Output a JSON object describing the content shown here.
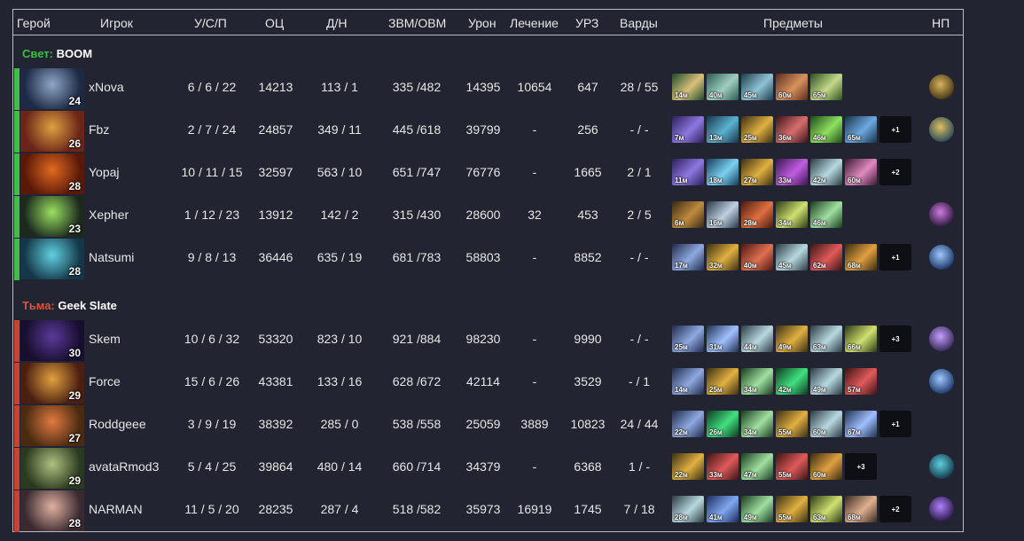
{
  "headers": [
    "Герой",
    "Игрок",
    "У/С/П",
    "ОЦ",
    "Д/Н",
    "ЗВМ/ОВМ",
    "Урон",
    "Лечение",
    "УРЗ",
    "Варды",
    "Предметы",
    "НП"
  ],
  "teams": [
    {
      "side": "Свет:",
      "name": "BOOM",
      "color": "#3fbf46",
      "players": [
        {
          "hero_icon": "mirana-portrait",
          "hero_colors": [
            "#1c2a44",
            "#8fa6c8"
          ],
          "level": "24",
          "player": "xNova",
          "kda": "6 / 6 / 22",
          "nw": "14213",
          "lh_dn": "113 / 1",
          "gpm_xpm": "335 /482",
          "damage": "14395",
          "heal": "10654",
          "building": "647",
          "wards": "28 / 55",
          "items": [
            {
              "name": "item-staff",
              "time": "14м",
              "colors": [
                "#1c4a2a",
                "#d9c07a"
              ]
            },
            {
              "name": "item-boots",
              "time": "40м",
              "colors": [
                "#2a5a52",
                "#9fd0c0"
              ]
            },
            {
              "name": "item-crystal",
              "time": "45м",
              "colors": [
                "#1d3c4a",
                "#8fc3d4"
              ]
            },
            {
              "name": "item-sword",
              "time": "60м",
              "colors": [
                "#5a2a1e",
                "#d8925c"
              ]
            },
            {
              "name": "item-orb",
              "time": "65м",
              "colors": [
                "#2c5020",
                "#c4d88a"
              ]
            }
          ],
          "np": {
            "name": "neutral-amulet-icon",
            "colors": [
              "#4a3a18",
              "#d8b25a"
            ]
          }
        },
        {
          "hero_icon": "brewmaster-portrait",
          "hero_colors": [
            "#6a2418",
            "#e0a040"
          ],
          "level": "26",
          "player": "Fbz",
          "kda": "2 / 7 / 24",
          "nw": "24857",
          "lh_dn": "349 / 11",
          "gpm_xpm": "445 /618",
          "damage": "39799",
          "heal": "-",
          "building": "256",
          "wards": "- / -",
          "items": [
            {
              "name": "item-arcane",
              "time": "7м",
              "colors": [
                "#2a1e5a",
                "#8e78e0"
              ]
            },
            {
              "name": "item-glimmer",
              "time": "13м",
              "colors": [
                "#16364a",
                "#5ab2d0"
              ]
            },
            {
              "name": "item-blink",
              "time": "25м",
              "colors": [
                "#3a2e14",
                "#e0b040"
              ]
            },
            {
              "name": "item-skull",
              "time": "36м",
              "colors": [
                "#3a1418",
                "#d86e6e"
              ]
            },
            {
              "name": "item-lotus",
              "time": "46м",
              "colors": [
                "#1e4a18",
                "#8ee060"
              ]
            },
            {
              "name": "item-heart",
              "time": "65м",
              "colors": [
                "#16324a",
                "#6ea8e0"
              ]
            },
            {
              "name": "item-more",
              "time": "+1",
              "more": true
            }
          ],
          "np": {
            "name": "neutral-compass-icon",
            "colors": [
              "#2a4a5a",
              "#e0c060"
            ]
          }
        },
        {
          "hero_icon": "ember-portrait",
          "hero_colors": [
            "#5a1808",
            "#e06a20"
          ],
          "level": "28",
          "player": "Yopaj",
          "kda": "10 / 11 / 15",
          "nw": "32597",
          "lh_dn": "563 / 10",
          "gpm_xpm": "651 /747",
          "damage": "76776",
          "heal": "-",
          "building": "1665",
          "wards": "2 / 1",
          "items": [
            {
              "name": "item-arcane",
              "time": "11м",
              "colors": [
                "#2a1e5a",
                "#8e78e0"
              ]
            },
            {
              "name": "item-swirl",
              "time": "18м",
              "colors": [
                "#163c5a",
                "#7ad0f0"
              ]
            },
            {
              "name": "item-blink",
              "time": "27м",
              "colors": [
                "#3a2e14",
                "#e0b040"
              ]
            },
            {
              "name": "item-dagon",
              "time": "33м",
              "colors": [
                "#3a1450",
                "#c05ee0"
              ]
            },
            {
              "name": "item-satanic",
              "time": "42м",
              "colors": [
                "#2a3a40",
                "#b8d8e0"
              ]
            },
            {
              "name": "item-butterfly",
              "time": "60м",
              "colors": [
                "#3a1830",
                "#e08ac0"
              ]
            },
            {
              "name": "item-more",
              "time": "+2",
              "more": true
            }
          ],
          "np": {
            "name": "neutral-empty",
            "colors": [
              "#222531",
              "#222531"
            ]
          }
        },
        {
          "hero_icon": "void-portrait",
          "hero_colors": [
            "#1c2a1e",
            "#9ae060"
          ],
          "level": "23",
          "player": "Xepher",
          "kda": "1 / 12 / 23",
          "nw": "13912",
          "lh_dn": "142 / 2",
          "gpm_xpm": "315 /430",
          "damage": "28600",
          "heal": "32",
          "building": "453",
          "wards": "2 / 5",
          "items": [
            {
              "name": "item-tranquil",
              "time": "6м",
              "colors": [
                "#3a2810",
                "#c08a40"
              ]
            },
            {
              "name": "item-force",
              "time": "16м",
              "colors": [
                "#263848",
                "#c0d0e0"
              ]
            },
            {
              "name": "item-rapier",
              "time": "28м",
              "colors": [
                "#4a1a10",
                "#e07040"
              ]
            },
            {
              "name": "item-radiance",
              "time": "34м",
              "colors": [
                "#2a3a14",
                "#d0e070"
              ]
            },
            {
              "name": "item-aghs",
              "time": "46м",
              "colors": [
                "#1a3a20",
                "#a0e0a0"
              ]
            }
          ],
          "np": {
            "name": "neutral-spear-icon",
            "colors": [
              "#2a1838",
              "#d07ae0"
            ]
          }
        },
        {
          "hero_icon": "morph-portrait",
          "hero_colors": [
            "#14384a",
            "#60d0e0"
          ],
          "level": "28",
          "player": "Natsumi",
          "kda": "9 / 8 / 13",
          "nw": "36446",
          "lh_dn": "635 / 19",
          "gpm_xpm": "681 /783",
          "damage": "58803",
          "heal": "-",
          "building": "8852",
          "wards": "- / -",
          "items": [
            {
              "name": "item-manta",
              "time": "17м",
              "colors": [
                "#1e2a4a",
                "#8ea8e0"
              ]
            },
            {
              "name": "item-blink",
              "time": "32м",
              "colors": [
                "#3a2e14",
                "#e0b040"
              ]
            },
            {
              "name": "item-daedalus",
              "time": "40м",
              "colors": [
                "#4a1610",
                "#e07050"
              ]
            },
            {
              "name": "item-satanic",
              "time": "45м",
              "colors": [
                "#2a3a40",
                "#b8d8e0"
              ]
            },
            {
              "name": "item-bloodthorn",
              "time": "62м",
              "colors": [
                "#3a1414",
                "#e05a5a"
              ]
            },
            {
              "name": "item-skadi",
              "time": "68м",
              "colors": [
                "#3a2a10",
                "#e0a040"
              ]
            },
            {
              "name": "item-more",
              "time": "+1",
              "more": true
            }
          ],
          "np": {
            "name": "neutral-orb-icon",
            "colors": [
              "#1e3a6a",
              "#a0c8ff"
            ]
          }
        }
      ]
    },
    {
      "side": "Тьма:",
      "name": "Geek Slate",
      "color": "#d8543e",
      "players": [
        {
          "hero_icon": "spectre-portrait",
          "hero_colors": [
            "#180e2e",
            "#5a3a9a"
          ],
          "level": "30",
          "player": "Skem",
          "kda": "10 / 6 / 32",
          "nw": "53320",
          "lh_dn": "823 / 10",
          "gpm_xpm": "921 /884",
          "damage": "98230",
          "heal": "-",
          "building": "9990",
          "wards": "- / -",
          "items": [
            {
              "name": "item-manta",
              "time": "25м",
              "colors": [
                "#1e2a4a",
                "#8ea8e0"
              ]
            },
            {
              "name": "item-ethereal",
              "time": "31м",
              "colors": [
                "#1e3050",
                "#a0c0ff"
              ]
            },
            {
              "name": "item-satanic",
              "time": "44м",
              "colors": [
                "#2a3a40",
                "#b8d8e0"
              ]
            },
            {
              "name": "item-blink",
              "time": "49м",
              "colors": [
                "#3a2e14",
                "#e0b040"
              ]
            },
            {
              "name": "item-skadi",
              "time": "63м",
              "colors": [
                "#2a3a40",
                "#b8d8e0"
              ]
            },
            {
              "name": "item-radiance",
              "time": "66м",
              "colors": [
                "#2a3a14",
                "#d0e070"
              ]
            },
            {
              "name": "item-more",
              "time": "+3",
              "more": true
            }
          ],
          "np": {
            "name": "neutral-mirror-icon",
            "colors": [
              "#3a2a5a",
              "#c0a0ff"
            ]
          }
        },
        {
          "hero_icon": "lion-portrait",
          "hero_colors": [
            "#4a1e10",
            "#e0a040"
          ],
          "level": "29",
          "player": "Force",
          "kda": "15 / 6 / 26",
          "nw": "43381",
          "lh_dn": "133 / 16",
          "gpm_xpm": "628 /672",
          "damage": "42114",
          "heal": "-",
          "building": "3529",
          "wards": "- / 1",
          "items": [
            {
              "name": "item-manta",
              "time": "14м",
              "colors": [
                "#1e2a4a",
                "#8ea8e0"
              ]
            },
            {
              "name": "item-blink",
              "time": "25м",
              "colors": [
                "#3a2e14",
                "#e0b040"
              ]
            },
            {
              "name": "item-aghs",
              "time": "34м",
              "colors": [
                "#1a3a20",
                "#a0e0a0"
              ]
            },
            {
              "name": "item-emerald",
              "time": "42м",
              "colors": [
                "#0e3a1e",
                "#40e080"
              ]
            },
            {
              "name": "item-satanic",
              "time": "49м",
              "colors": [
                "#2a3a40",
                "#b8d8e0"
              ]
            },
            {
              "name": "item-bloodthorn",
              "time": "57м",
              "colors": [
                "#3a1414",
                "#e05a5a"
              ]
            }
          ],
          "np": {
            "name": "neutral-orb-icon",
            "colors": [
              "#1e3a6a",
              "#a0c8ff"
            ]
          }
        },
        {
          "hero_icon": "windrunner-portrait",
          "hero_colors": [
            "#4a2a10",
            "#e07a40"
          ],
          "level": "27",
          "player": "Roddgeee",
          "kda": "3 / 9 / 19",
          "nw": "38392",
          "lh_dn": "285 / 0",
          "gpm_xpm": "538 /558",
          "damage": "25059",
          "heal": "3889",
          "building": "10823",
          "wards": "24 / 44",
          "items": [
            {
              "name": "item-manta",
              "time": "22м",
              "colors": [
                "#1e2a4a",
                "#8ea8e0"
              ]
            },
            {
              "name": "item-emerald",
              "time": "26м",
              "colors": [
                "#0e3a1e",
                "#40e080"
              ]
            },
            {
              "name": "item-aghs",
              "time": "34м",
              "colors": [
                "#1a3a20",
                "#a0e0a0"
              ]
            },
            {
              "name": "item-blink",
              "time": "55м",
              "colors": [
                "#3a2e14",
                "#e0b040"
              ]
            },
            {
              "name": "item-satanic",
              "time": "60м",
              "colors": [
                "#2a3a40",
                "#b8d8e0"
              ]
            },
            {
              "name": "item-ethereal",
              "time": "67м",
              "colors": [
                "#1e3050",
                "#a0c0ff"
              ]
            },
            {
              "name": "item-more",
              "time": "+1",
              "more": true
            }
          ],
          "np": {
            "name": "neutral-empty",
            "colors": [
              "#222531",
              "#222531"
            ]
          }
        },
        {
          "hero_icon": "sand-king-portrait",
          "hero_colors": [
            "#2a3a1e",
            "#b0c080"
          ],
          "level": "29",
          "player": "avataRmod3",
          "kda": "5 / 4 / 25",
          "nw": "39864",
          "lh_dn": "480 / 14",
          "gpm_xpm": "660 /714",
          "damage": "34379",
          "heal": "-",
          "building": "6368",
          "wards": "1 / -",
          "items": [
            {
              "name": "item-blink",
              "time": "22м",
              "colors": [
                "#3a2e14",
                "#e0b040"
              ]
            },
            {
              "name": "item-bloodthorn",
              "time": "33м",
              "colors": [
                "#3a1414",
                "#e05a5a"
              ]
            },
            {
              "name": "item-aghs",
              "time": "47м",
              "colors": [
                "#1a3a20",
                "#a0e0a0"
              ]
            },
            {
              "name": "item-bloodthorn",
              "time": "55м",
              "colors": [
                "#3a1414",
                "#e05a5a"
              ]
            },
            {
              "name": "item-skadi",
              "time": "60м",
              "colors": [
                "#3a2a10",
                "#e0a040"
              ]
            },
            {
              "name": "item-more",
              "time": "+3",
              "more": true
            }
          ],
          "np": {
            "name": "neutral-lens-icon",
            "colors": [
              "#143a4a",
              "#60d0e0"
            ]
          }
        },
        {
          "hero_icon": "tinker-portrait",
          "hero_colors": [
            "#3a2a30",
            "#e0b0a0"
          ],
          "level": "28",
          "player": "NARMAN",
          "kda": "11 / 5 / 20",
          "nw": "28235",
          "lh_dn": "287 / 4",
          "gpm_xpm": "518 /582",
          "damage": "35973",
          "heal": "16919",
          "building": "1745",
          "wards": "7 / 18",
          "items": [
            {
              "name": "item-satanic",
              "time": "28м",
              "colors": [
                "#2a3a40",
                "#b8d8e0"
              ]
            },
            {
              "name": "item-staff",
              "time": "41м",
              "colors": [
                "#1c2a5a",
                "#80a8f0"
              ]
            },
            {
              "name": "item-aghs",
              "time": "49м",
              "colors": [
                "#1a3a20",
                "#a0e0a0"
              ]
            },
            {
              "name": "item-blink",
              "time": "55м",
              "colors": [
                "#3a2e14",
                "#e0b040"
              ]
            },
            {
              "name": "item-radiance",
              "time": "63м",
              "colors": [
                "#2a3a14",
                "#d0e070"
              ]
            },
            {
              "name": "item-skadi",
              "time": "68м",
              "colors": [
                "#3a2a20",
                "#e0b090"
              ]
            },
            {
              "name": "item-more",
              "time": "+2",
              "more": true
            }
          ],
          "np": {
            "name": "neutral-prism-icon",
            "colors": [
              "#2a1a4a",
              "#b080ff"
            ]
          }
        }
      ]
    }
  ]
}
